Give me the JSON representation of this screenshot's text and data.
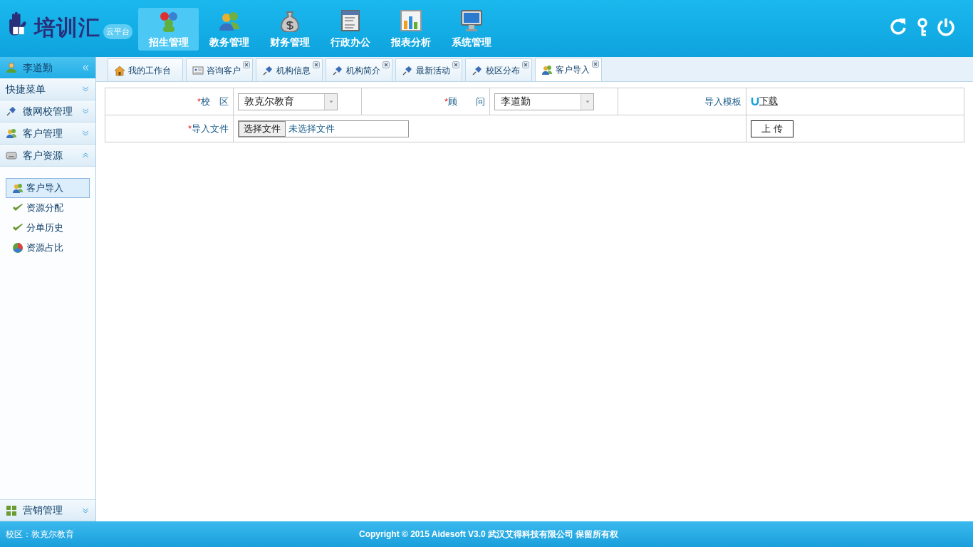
{
  "logo": {
    "title": "培训汇",
    "badge": "云平台"
  },
  "modules": [
    {
      "label": "招生管理",
      "selected": true
    },
    {
      "label": "教务管理",
      "selected": false
    },
    {
      "label": "财务管理",
      "selected": false
    },
    {
      "label": "行政办公",
      "selected": false
    },
    {
      "label": "报表分析",
      "selected": false
    },
    {
      "label": "系统管理",
      "selected": false
    }
  ],
  "sidebar": {
    "user": "李道勤",
    "sections": [
      {
        "label": "快捷菜单",
        "expanded": false
      },
      {
        "label": "微网校管理",
        "expanded": false
      },
      {
        "label": "客户管理",
        "expanded": false
      },
      {
        "label": "客户资源",
        "expanded": true,
        "items": [
          {
            "label": "客户导入",
            "selected": true
          },
          {
            "label": "资源分配",
            "selected": false
          },
          {
            "label": "分单历史",
            "selected": false
          },
          {
            "label": "资源占比",
            "selected": false
          }
        ]
      }
    ],
    "bottom_section": {
      "label": "营销管理",
      "expanded": false
    }
  },
  "tabs": [
    {
      "label": "我的工作台",
      "closable": false,
      "selected": false
    },
    {
      "label": "咨询客户",
      "closable": true,
      "selected": false
    },
    {
      "label": "机构信息",
      "closable": true,
      "selected": false
    },
    {
      "label": "机构简介",
      "closable": true,
      "selected": false
    },
    {
      "label": "最新活动",
      "closable": true,
      "selected": false
    },
    {
      "label": "校区分布",
      "closable": true,
      "selected": false
    },
    {
      "label": "客户导入",
      "closable": true,
      "selected": true
    }
  ],
  "form": {
    "campus": {
      "mark": "*",
      "label": "校　区",
      "value": "敦克尔教育"
    },
    "advisor": {
      "mark": "*",
      "label": "顾　　问",
      "value": "李道勤"
    },
    "template": {
      "label": "导入模板",
      "link": "下载"
    },
    "file": {
      "mark": "*",
      "label": "导入文件",
      "button": "选择文件",
      "status": "未选择文件"
    },
    "upload_button": "上 传"
  },
  "footer": {
    "campus": "校区：敦克尔教育",
    "copyright": "Copyright © 2015 Aidesoft V3.0 武汉艾得科技有限公司 保留所有权"
  }
}
